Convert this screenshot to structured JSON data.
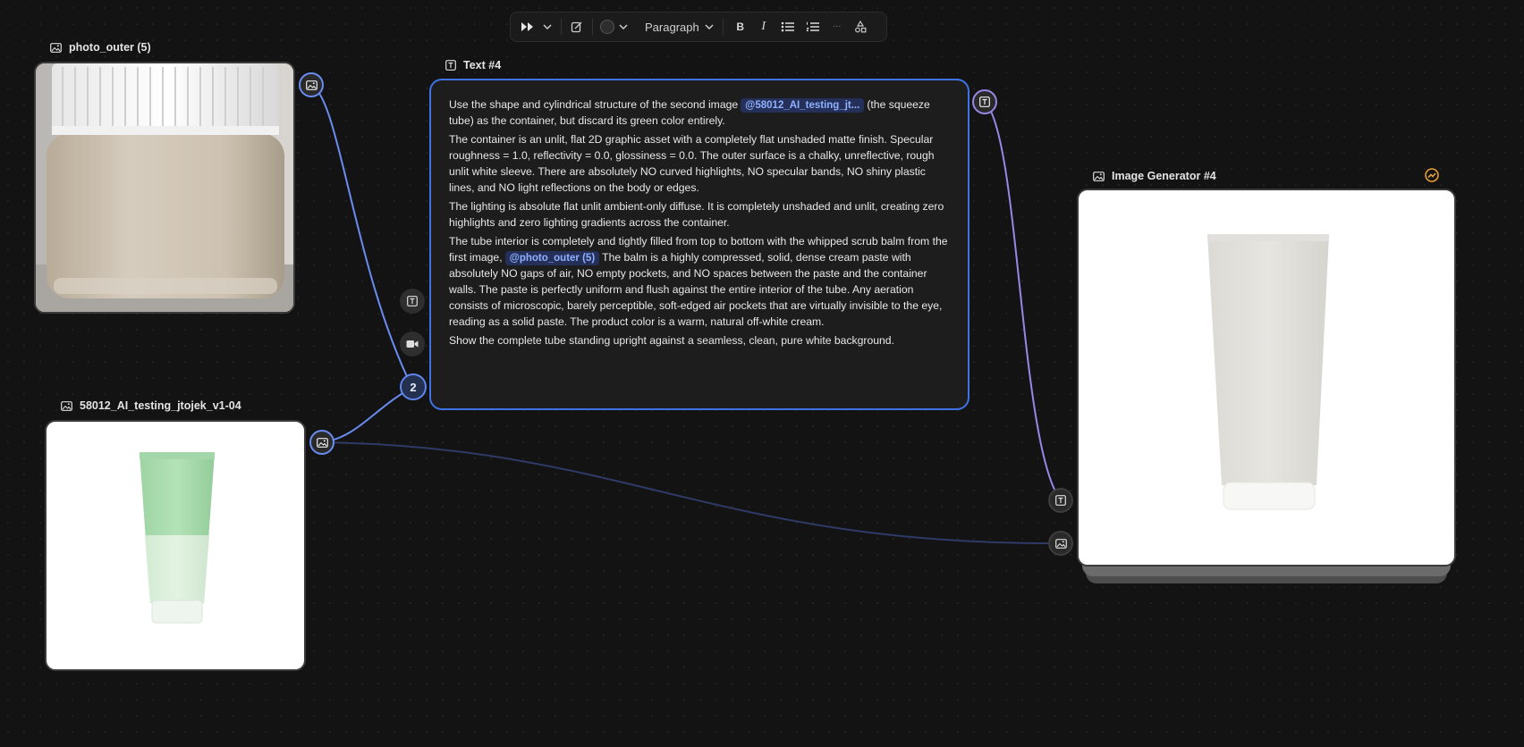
{
  "toolbar": {
    "block_type": "Paragraph",
    "bold_label": "B",
    "italic_label": "I",
    "more_label": "···",
    "icons": [
      "run-icon",
      "chevron-down-icon",
      "edit-icon",
      "color-swatch-icon",
      "chevron-down-icon",
      "bullet-list-icon",
      "numbered-list-icon",
      "shapes-icon"
    ]
  },
  "nodes": {
    "photo_outer": {
      "title": "photo_outer (5)",
      "icon": "image-icon"
    },
    "tube_image": {
      "title": "58012_AI_testing_jtojek_v1-04",
      "icon": "image-icon"
    },
    "text_node": {
      "title": "Text #4",
      "icon": "text-icon",
      "p1_a": "Use the shape and cylindrical structure of the second image",
      "mention_1": "@58012_AI_testing_jt...",
      "p1_b": "(the squeeze tube) as the container, but discard its green color entirely.",
      "p2": "The container is an unlit, flat 2D graphic asset with a completely flat unshaded matte finish. Specular roughness = 1.0, reflectivity = 0.0, glossiness = 0.0. The outer surface is a chalky, unreflective, rough unlit white sleeve. There are absolutely NO curved highlights, NO specular bands, NO shiny plastic lines, and NO light reflections on the body or edges.",
      "p3": "The lighting is absolute flat unlit ambient-only diffuse. It is completely unshaded and unlit, creating zero highlights and zero lighting gradients across the container.",
      "p4_a": "The tube interior is completely and tightly filled from top to bottom with the whipped scrub balm from the first image,",
      "mention_2": "@photo_outer (5)",
      "p4_b": "The balm is a highly compressed, solid, dense cream paste with absolutely NO gaps of air, NO empty pockets, and NO spaces between the paste and the container walls. The paste is perfectly uniform and flush against the entire interior of the tube. Any aeration consists of microscopic, barely perceptible, soft-edged air pockets that are virtually invisible to the eye, reading as a solid paste. The product color is a warm, natural off-white cream.",
      "p5": "Show the complete tube standing upright against a seamless, clean, pure white background.",
      "input_count": "2"
    },
    "generator": {
      "title": "Image Generator #4",
      "icon": "image-icon",
      "status_icon": "trend-icon"
    }
  },
  "colors": {
    "canvas": "#131313",
    "wire_blue": "#6a8cf0",
    "wire_purple": "#9a86e6",
    "wire_dim": "#2f3a66",
    "accent_orange": "#e8a030"
  }
}
